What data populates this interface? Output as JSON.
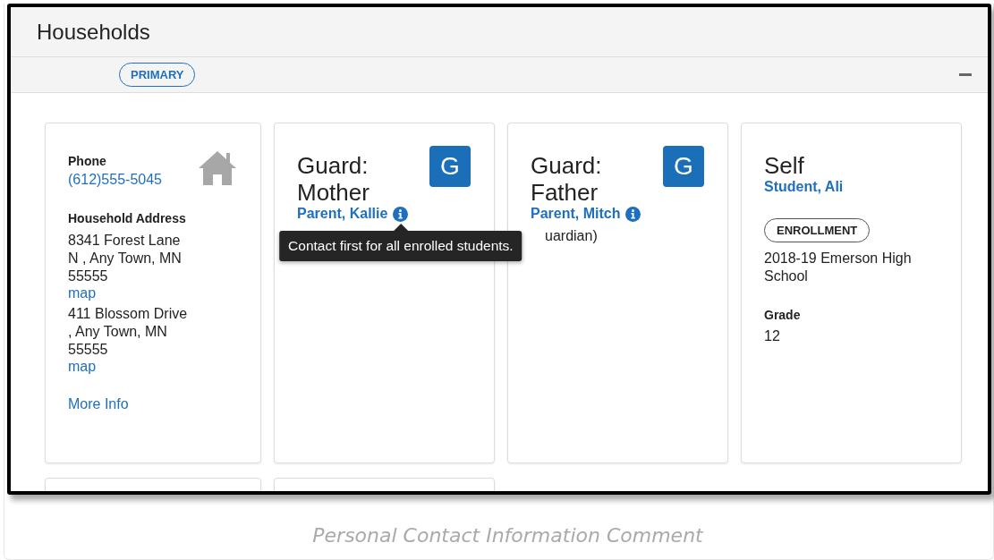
{
  "panel": {
    "title": "Households",
    "badge": "PRIMARY"
  },
  "cards": [
    {
      "kind": "household",
      "phone_label": "Phone",
      "phone": "(612)555-5045",
      "address_label": "Household Address",
      "addresses": [
        {
          "text": "8341 Forest Lane N , Any Town, MN 55555",
          "link": "map"
        },
        {
          "text": "411 Blossom Drive , Any Town, MN 55555",
          "link": "map"
        }
      ],
      "more": "More Info"
    },
    {
      "kind": "guardian",
      "title": "Guard: Mother",
      "badge": "G",
      "name": "Parent, Kallie",
      "tooltip": "Contact first for all enrolled students."
    },
    {
      "kind": "guardian",
      "title": "Guard: Father",
      "badge": "G",
      "name": "Parent, Mitch",
      "note": "uardian)"
    },
    {
      "kind": "student",
      "title": "Self",
      "name": "Student, Ali",
      "badge": "ENROLLMENT",
      "school": "2018-19 Emerson High School",
      "grade_label": "Grade",
      "grade": "12"
    },
    {
      "kind": "empty"
    },
    {
      "kind": "empty"
    }
  ],
  "caption": "Personal Contact Information Comment"
}
